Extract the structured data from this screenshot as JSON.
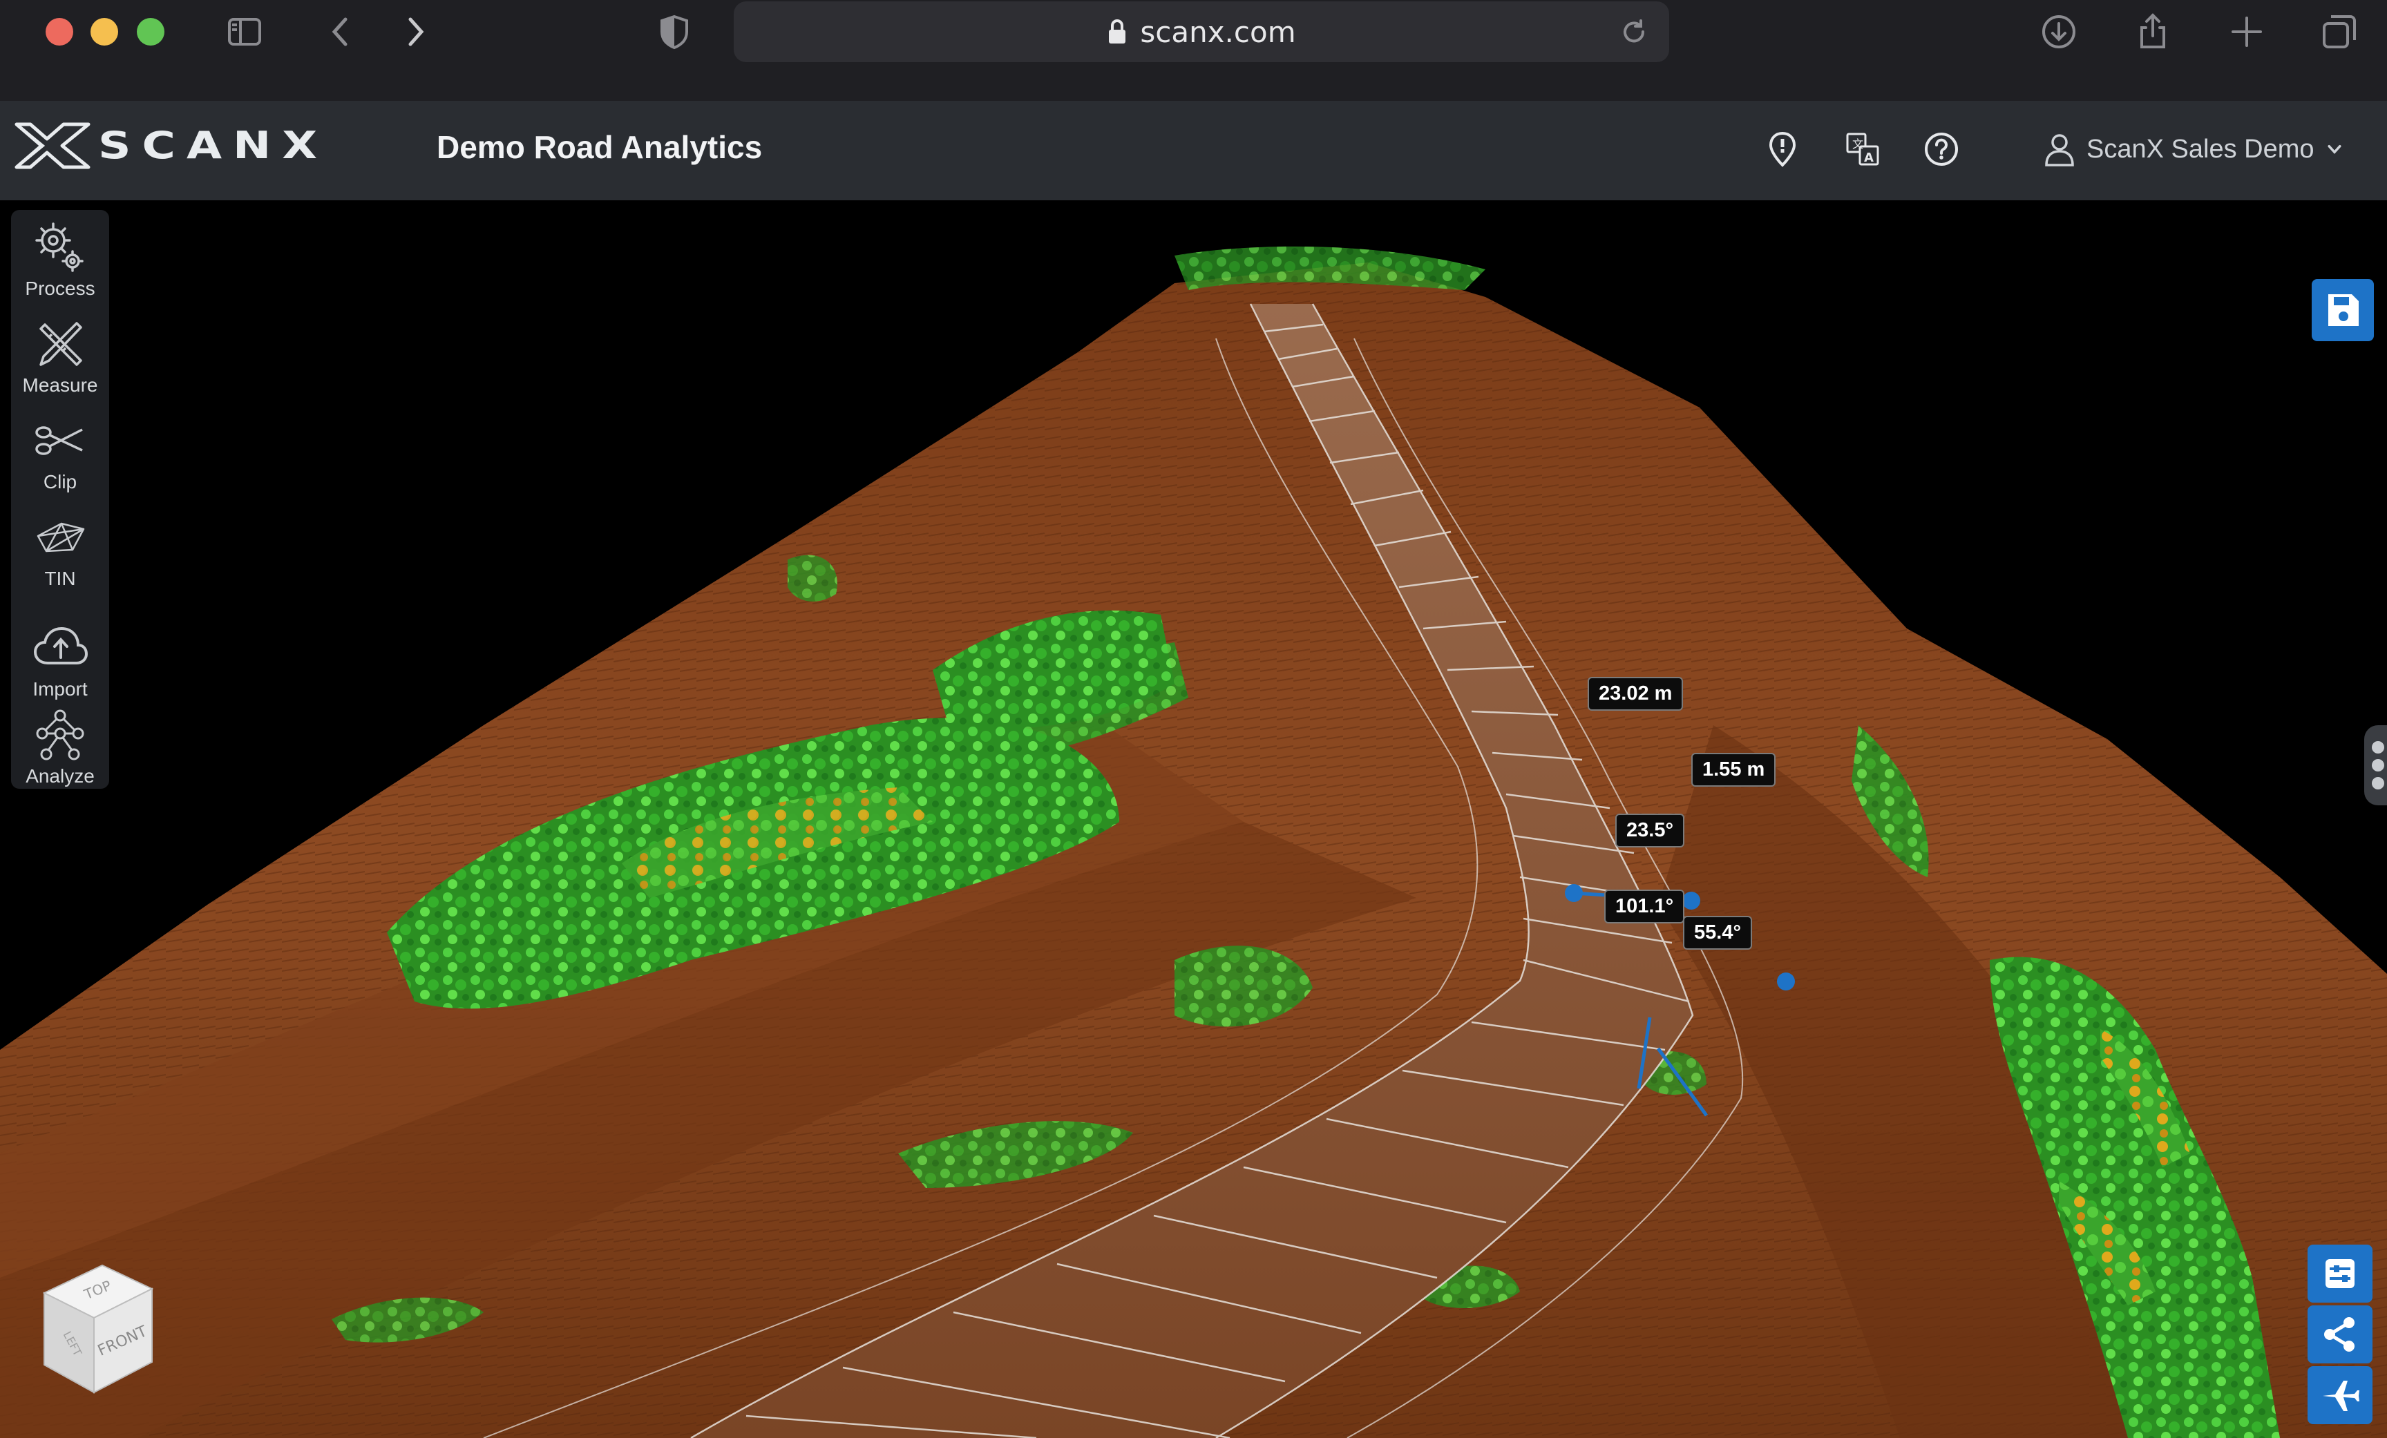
{
  "browser": {
    "url": "scanx.com",
    "icons": [
      "sidebar-icon",
      "back-icon",
      "forward-icon",
      "shield-icon",
      "lock-icon",
      "reload-icon",
      "download-icon",
      "share-icon",
      "new-tab-icon",
      "tabs-icon"
    ]
  },
  "header": {
    "logo_text": "SCANX",
    "project_title": "Demo Road Analytics",
    "icons": [
      "location-pin-icon",
      "translate-icon",
      "help-icon"
    ],
    "user_name": "ScanX Sales Demo"
  },
  "tools": [
    {
      "label": "Process",
      "icon": "gears-icon"
    },
    {
      "label": "Measure",
      "icon": "ruler-pencil-icon"
    },
    {
      "label": "Clip",
      "icon": "scissors-icon"
    },
    {
      "label": "TIN",
      "icon": "tin-mesh-icon"
    },
    {
      "label": "Import",
      "icon": "cloud-upload-icon"
    },
    {
      "label": "Analyze",
      "icon": "network-graph-icon"
    }
  ],
  "measurements": {
    "distance_1": "23.02 m",
    "height_1": "1.55 m",
    "angle_a": "23.5°",
    "angle_b": "101.1°",
    "angle_c": "55.4°"
  },
  "right_buttons": [
    "save-icon",
    "settings-sliders-icon",
    "share-nodes-icon",
    "airplane-icon"
  ],
  "viewcube": {
    "top": "TOP",
    "front": "FRONT",
    "left": "LEFT"
  },
  "colors": {
    "terrain": "#8a4a20",
    "vegetation": "#2fa52a",
    "accent": "#1e73c7",
    "header_bg": "#2a2d32"
  }
}
